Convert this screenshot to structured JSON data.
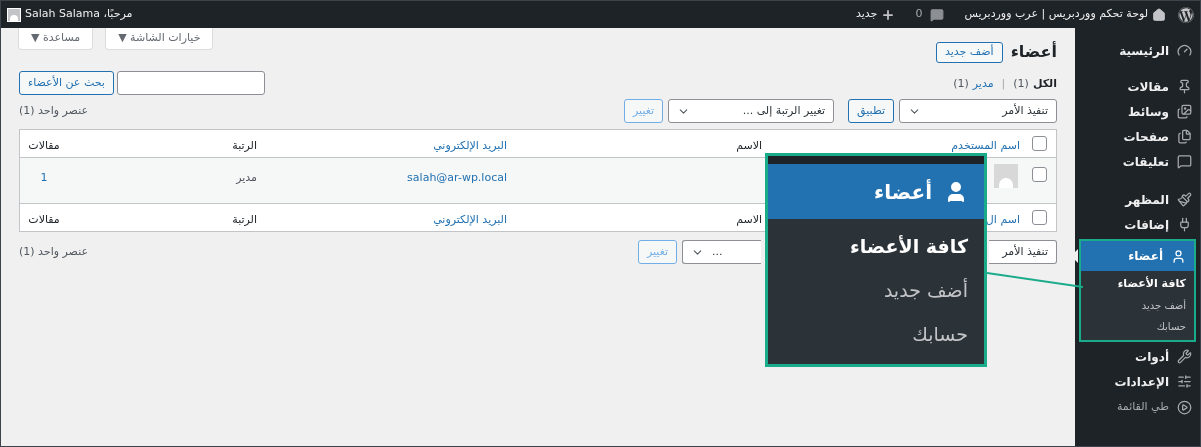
{
  "admin_bar": {
    "site": "لوحة تحكم ووردبريس | عرب ووردبريس",
    "comments": "0",
    "new": "جديد",
    "greeting": "مرحبًا، Salah Salama"
  },
  "sidebar": {
    "groups": [
      [
        {
          "label": "الرئيسية",
          "selected": false
        }
      ],
      [
        {
          "label": "مقالات",
          "selected": false
        },
        {
          "label": "وسائط",
          "selected": false
        },
        {
          "label": "صفحات",
          "selected": false
        },
        {
          "label": "تعليقات",
          "selected": false
        }
      ],
      [
        {
          "label": "المظهر",
          "selected": false
        },
        {
          "label": "إضافات",
          "selected": false
        },
        {
          "label": "أعضاء",
          "selected": true,
          "children": [
            {
              "label": "كافة الأعضاء",
              "selected": true
            },
            {
              "label": "أضف جديد",
              "selected": false
            },
            {
              "label": "حسابك",
              "selected": false
            }
          ]
        },
        {
          "label": "أدوات",
          "selected": false
        },
        {
          "label": "الإعدادات",
          "selected": false
        }
      ]
    ],
    "collapse": "طي القائمة"
  },
  "screen_meta": [
    {
      "label": "خيارات الشاشة ▼"
    },
    {
      "label": "مساعدة ▼"
    }
  ],
  "page": {
    "title": "أعضاء",
    "add_new": "أضف جديد",
    "views": [
      {
        "label": "الكل",
        "count": "(1)",
        "selected": true
      },
      {
        "label": "مدير",
        "count": "(1)",
        "selected": false
      }
    ],
    "view_separator": "|",
    "search": {
      "button": "بحث عن الأعضاء"
    },
    "top_nav": {
      "bulk": "تنفيذ الأمر",
      "apply": "تطبيق",
      "role": "تغيير الرتبة إلى ...",
      "change": "تغيير",
      "count": "عنصر واحد (1)"
    },
    "table": {
      "header_checked": false,
      "footer_checked": false,
      "columns": [
        "اسم المستخدم",
        "الاسم",
        "البريد الإلكتروني",
        "الرتبة",
        "مقالات"
      ],
      "rows": [
        {
          "checked": false,
          "email": "salah@ar-wp.local",
          "role": "مدير",
          "posts": "1"
        }
      ],
      "footer": [
        "اسم ال",
        "الاسم",
        "البريد الإلكتروني",
        "الرتبة",
        "مقالات"
      ]
    },
    "bottom_nav": {
      "bulk": "تنفيذ الأمر",
      "role": "...",
      "change": "تغيير",
      "count": "عنصر واحد (1)"
    }
  },
  "callout": {
    "header": "أعضاء",
    "items": [
      {
        "label": "كافة الأعضاء",
        "selected": true
      },
      {
        "label": "أضف جديد",
        "selected": false
      },
      {
        "label": "حسابك",
        "selected": false
      }
    ]
  }
}
